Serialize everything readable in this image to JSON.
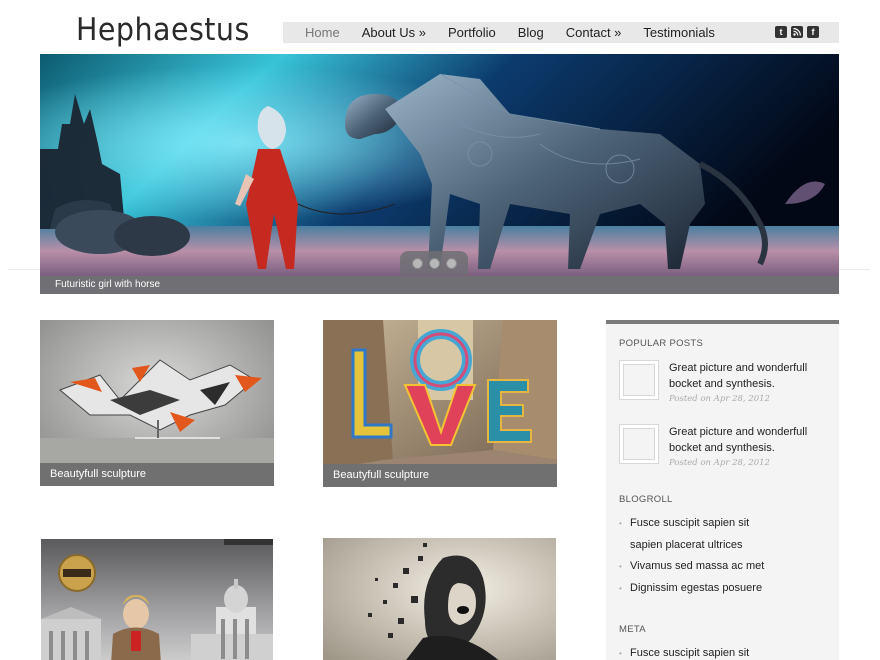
{
  "site": {
    "logo": "Hephaestus"
  },
  "nav": {
    "items": [
      {
        "label": "Home"
      },
      {
        "label": "About Us »"
      },
      {
        "label": "Portfolio"
      },
      {
        "label": "Blog"
      },
      {
        "label": "Contact »"
      },
      {
        "label": "Testimonials"
      }
    ],
    "social": [
      {
        "icon": "twitter-icon",
        "glyph": "t"
      },
      {
        "icon": "rss-icon",
        "glyph": "◤"
      },
      {
        "icon": "facebook-icon",
        "glyph": "f"
      }
    ]
  },
  "slider": {
    "caption": "Futuristic girl with horse",
    "dots": 3,
    "active_dot": 2
  },
  "portfolio": {
    "tiles": [
      {
        "caption": "Beautyfull sculpture"
      },
      {
        "caption": "Beautyfull sculpture"
      },
      {
        "caption": ""
      },
      {
        "caption": ""
      }
    ]
  },
  "sidebar": {
    "popular_heading": "POPULAR POSTS",
    "posts": [
      {
        "title": "Great picture and wonderfull bocket and synthesis.",
        "date": "Posted on Apr 28, 2012"
      },
      {
        "title": "Great picture and wonderfull bocket and synthesis.",
        "date": "Posted on Apr 28, 2012"
      }
    ],
    "blogroll_heading": "BLOGROLL",
    "blogroll": [
      {
        "line1": "Fusce suscipit sapien sit",
        "line2": "sapien placerat ultrices"
      },
      {
        "line1": "Vivamus sed massa ac met"
      },
      {
        "line1": "Dignissim egestas posuere"
      }
    ],
    "meta_heading": "META",
    "meta": [
      {
        "line1": "Fusce suscipit sapien sit"
      }
    ]
  },
  "colors": {
    "nav_bg": "#e8e8e8",
    "caption_bar": "#707070",
    "sidebar_bg": "#f4f4f4",
    "sidebar_border": "#7a7a7a"
  }
}
